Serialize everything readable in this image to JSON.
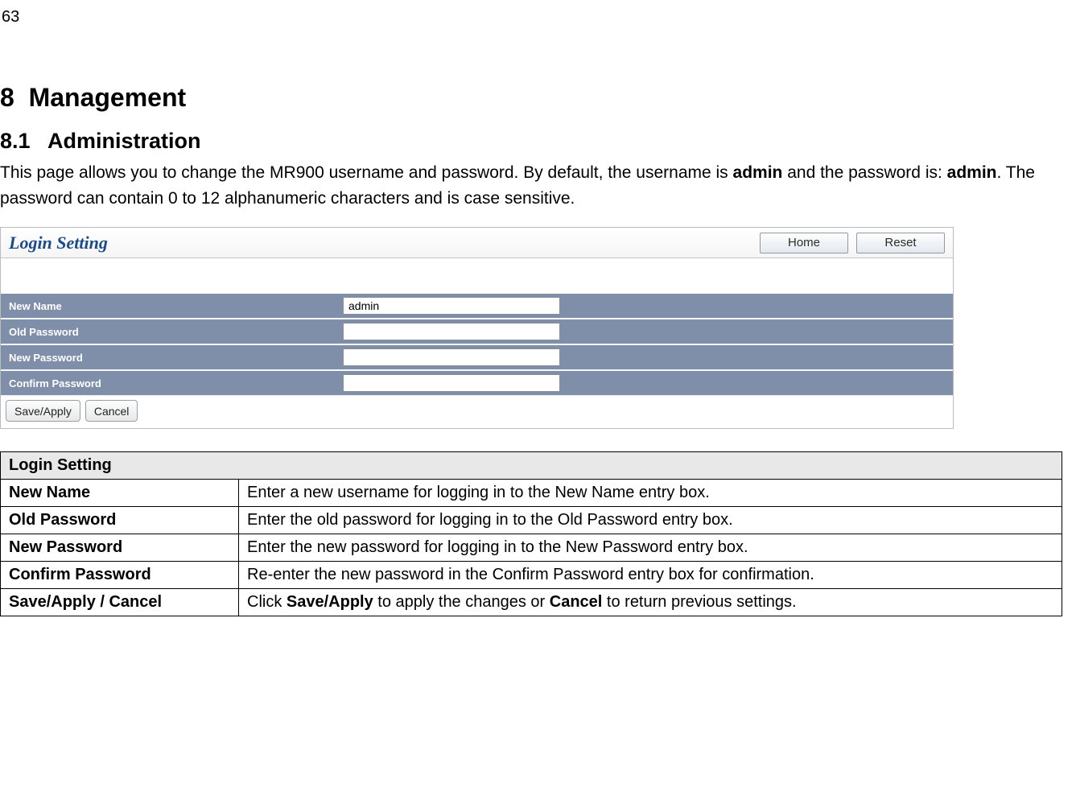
{
  "page_number": "63",
  "heading1": "8  Management",
  "heading2": "8.1   Administration",
  "intro": {
    "p1a": "This page allows you to change the MR900 username and password. By default, the username is ",
    "p1b": "admin",
    "p1c": " and the password is: ",
    "p1d": "admin",
    "p1e": ". The password can contain 0 to 12 alphanumeric characters and is case sensitive."
  },
  "panel": {
    "title": "Login Setting",
    "buttons": {
      "home": "Home",
      "reset": "Reset"
    },
    "rows": {
      "new_name": {
        "label": "New Name",
        "value": "admin"
      },
      "old_password": {
        "label": "Old Password",
        "value": ""
      },
      "new_password": {
        "label": "New Password",
        "value": ""
      },
      "confirm_password": {
        "label": "Confirm Password",
        "value": ""
      }
    },
    "actions": {
      "save": "Save/Apply",
      "cancel": "Cancel"
    }
  },
  "table": {
    "header": "Login Setting",
    "rows": [
      {
        "name": "New Name",
        "desc": "Enter a new username for logging in to the New Name entry box."
      },
      {
        "name": "Old Password",
        "desc": "Enter the old password for logging in to the Old Password entry box."
      },
      {
        "name": "New Password",
        "desc": "Enter the new password for logging in to the New Password entry box."
      },
      {
        "name": "Confirm Password",
        "desc": "Re-enter the new password in the Confirm Password entry box for confirmation."
      },
      {
        "name": "Save/Apply / Cancel",
        "desc_pre": "Click ",
        "desc_b1": "Save/Apply",
        "desc_mid": " to apply the changes or ",
        "desc_b2": "Cancel",
        "desc_post": " to return previous settings."
      }
    ]
  }
}
